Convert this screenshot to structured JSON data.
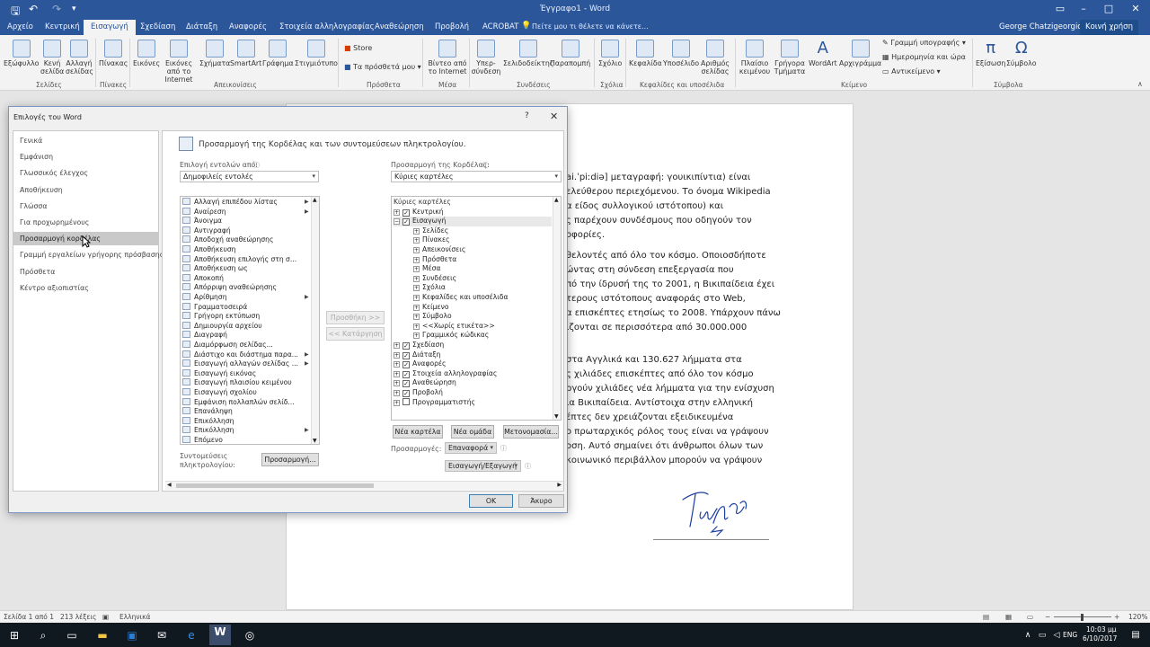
{
  "window": {
    "doc_title": "Έγγραφο1 - Word",
    "user": "George Chatzigeorgiou",
    "share": "Κοινή χρήση",
    "tell_me": "Πείτε μου τι θέλετε να κάνετε..."
  },
  "tabs": [
    "Αρχείο",
    "Κεντρική",
    "Εισαγωγή",
    "Σχεδίαση",
    "Διάταξη",
    "Αναφορές",
    "Στοιχεία αλληλογραφίας",
    "Αναθεώρηση",
    "Προβολή",
    "ACROBAT"
  ],
  "ribbon": {
    "buttons": {
      "cover": "Εξώφυλλο",
      "blank": "Κενή σελίδα",
      "break": "Αλλαγή σελίδας",
      "table": "Πίνακας",
      "pictures": "Εικόνες",
      "online_pictures": "Εικόνες από το Internet",
      "shapes": "Σχήματα",
      "smartart": "SmartArt",
      "chart": "Γράφημα",
      "screenshot": "Στιγμιότυπο",
      "store": "Store",
      "addins": "Τα πρόσθετά μου",
      "video": "Βίντεο από το Internet",
      "hyperlink": "Υπερ-σύνδεση",
      "bookmark": "Σελιδοδείκτης",
      "crossref": "Παραπομπή",
      "comment": "Σχόλιο",
      "header": "Κεφαλίδα",
      "footer": "Υποσέλιδο",
      "pagenum": "Αριθμός σελίδας",
      "textbox": "Πλαίσιο κειμένου",
      "quickparts": "Γρήγορα Τμήματα",
      "wordart": "WordArt",
      "dropcap": "Αρχιγράμμα",
      "equation": "Εξίσωση",
      "symbol": "Σύμβολο",
      "sigline": "Γραμμή υπογραφής",
      "datetime": "Ημερομηνία και ώρα",
      "object": "Αντικείμενο"
    },
    "groups": {
      "pages": "Σελίδες",
      "tables": "Πίνακες",
      "illustrations": "Απεικονίσεις",
      "addins": "Πρόσθετα",
      "media": "Μέσα",
      "links": "Συνδέσεις",
      "comments": "Σχόλια",
      "headerfooter": "Κεφαλίδες και υποσέλιδα",
      "text": "Κείμενο",
      "symbols": "Σύμβολα"
    }
  },
  "document": {
    "lines": [
      "ai.ˈpiːdiə] μεταγραφή: γουικιπίντια) είναι",
      "ελεύθερου περιεχόμενου. Το όνομα Wikipedia",
      "α είδος συλλογικού ιστότοπου) και",
      "ς παρέχουν συνδέσμους που οδηγούν τον",
      "οφορίες.",
      "θελοντές από όλο τον κόσμο. Οποιοσδήποτε",
      "ώντας στη σύνδεση επεξεργασία που",
      "πό την ίδρυσή της το 2001, η Βικιπαίδεια έχει",
      "τερους ιστότοπους αναφοράς στο Web,",
      "α επισκέπτες ετησίως το 2008. Υπάρχουν πάνω",
      "ιζονται σε περισσότερα από 30.000.000",
      "στα Αγγλικά και 130.627 λήμματα στα",
      "ς χιλιάδες επισκέπτες από όλο τον κόσμο",
      "ργούν χιλιάδες νέα λήμματα για την ενίσχυση",
      "ια Βικιπαίδεια. Αντίστοιχα στην ελληνική",
      "έπτες δεν χρειάζονται εξειδικευμένα",
      "ο πρωταρχικός ρόλος τους είναι να γράψουν",
      "οση. Αυτό σημαίνει ότι άνθρωποι όλων των",
      "κοινωνικό περιβάλλον μπορούν να γράψουν"
    ]
  },
  "status": {
    "page": "Σελίδα 1 από 1",
    "words": "213 λέξεις",
    "lang": "Ελληνικά",
    "zoom": "120%"
  },
  "taskbar": {
    "lang": "ENG",
    "time": "10:03 μμ",
    "date": "6/10/2017"
  },
  "dialog": {
    "title": "Επιλογές του Word",
    "help": "?",
    "close": "✕",
    "nav": [
      "Γενικά",
      "Εμφάνιση",
      "Γλωσσικός έλεγχος",
      "Αποθήκευση",
      "Γλώσσα",
      "Για προχωρημένους",
      "Προσαρμογή κορδέλας",
      "Γραμμή εργαλείων γρήγορης πρόσβασης",
      "Πρόσθετα",
      "Κέντρο αξιοπιστίας"
    ],
    "heading": "Προσαρμογή της Κορδέλας και των συντομεύσεων πληκτρολογίου.",
    "choose_label": "Επιλογή εντολών από:",
    "choose_value": "Δημοφιλείς εντολές",
    "customize_label": "Προσαρμογή της Κορδέλας:",
    "customize_value": "Κύριες καρτέλες",
    "commands": [
      "Αλλαγή επιπέδου λίστας",
      "Αναίρεση",
      "Άνοιγμα",
      "Αντιγραφή",
      "Αποδοχή αναθεώρησης",
      "Αποθήκευση",
      "Αποθήκευση επιλογής στη σ...",
      "Αποθήκευση ως",
      "Αποκοπή",
      "Απόρριψη αναθεώρησης",
      "Αρίθμηση",
      "Γραμματοσειρά",
      "Γρήγορη εκτύπωση",
      "Δημιουργία αρχείου",
      "Διαγραφή",
      "Διαμόρφωση σελίδας...",
      "Διάστιχο και διάστημα παρα...",
      "Εισαγωγή αλλαγών σελίδας ...",
      "Εισαγωγή εικόνας",
      "Εισαγωγή πλαισίου κειμένου",
      "Εισαγωγή σχολίου",
      "Εμφάνιση πολλαπλών σελίδ...",
      "Επανάληψη",
      "Επικόλληση",
      "Επικόλληση",
      "Επόμενο"
    ],
    "add_button": "Προσθήκη >>",
    "remove_button": "<< Κατάργηση",
    "tree": [
      {
        "label": "Κύριες καρτέλες",
        "level": 0,
        "kind": "header"
      },
      {
        "label": "Κεντρική",
        "level": 1,
        "kind": "tab"
      },
      {
        "label": "Εισαγωγή",
        "level": 1,
        "kind": "tab-open"
      },
      {
        "label": "Σελίδες",
        "level": 2,
        "kind": "group"
      },
      {
        "label": "Πίνακες",
        "level": 2,
        "kind": "group"
      },
      {
        "label": "Απεικονίσεις",
        "level": 2,
        "kind": "group"
      },
      {
        "label": "Πρόσθετα",
        "level": 2,
        "kind": "group"
      },
      {
        "label": "Μέσα",
        "level": 2,
        "kind": "group"
      },
      {
        "label": "Συνδέσεις",
        "level": 2,
        "kind": "group"
      },
      {
        "label": "Σχόλια",
        "level": 2,
        "kind": "group"
      },
      {
        "label": "Κεφαλίδες και υποσέλιδα",
        "level": 2,
        "kind": "group"
      },
      {
        "label": "Κείμενο",
        "level": 2,
        "kind": "group"
      },
      {
        "label": "Σύμβολο",
        "level": 2,
        "kind": "group"
      },
      {
        "label": "<<Χωρίς ετικέτα>>",
        "level": 2,
        "kind": "group"
      },
      {
        "label": "Γραμμικός κώδικας",
        "level": 2,
        "kind": "group"
      },
      {
        "label": "Σχεδίαση",
        "level": 1,
        "kind": "tab"
      },
      {
        "label": "Διάταξη",
        "level": 1,
        "kind": "tab"
      },
      {
        "label": "Αναφορές",
        "level": 1,
        "kind": "tab"
      },
      {
        "label": "Στοιχεία αλληλογραφίας",
        "level": 1,
        "kind": "tab"
      },
      {
        "label": "Αναθεώρηση",
        "level": 1,
        "kind": "tab"
      },
      {
        "label": "Προβολή",
        "level": 1,
        "kind": "tab"
      },
      {
        "label": "Προγραμματιστής",
        "level": 1,
        "kind": "tab-unchecked"
      }
    ],
    "new_tab": "Νέα καρτέλα",
    "new_group": "Νέα ομάδα",
    "rename": "Μετονομασία...",
    "customizations_label": "Προσαρμογές:",
    "reset": "Επαναφορά",
    "import_export": "Εισαγωγή/Εξαγωγή",
    "shortcuts_label_1": "Συντομεύσεις",
    "shortcuts_label_2": "πληκτρολογίου:",
    "shortcuts_button": "Προσαρμογή...",
    "ok": "OK",
    "cancel": "Άκυρο"
  }
}
